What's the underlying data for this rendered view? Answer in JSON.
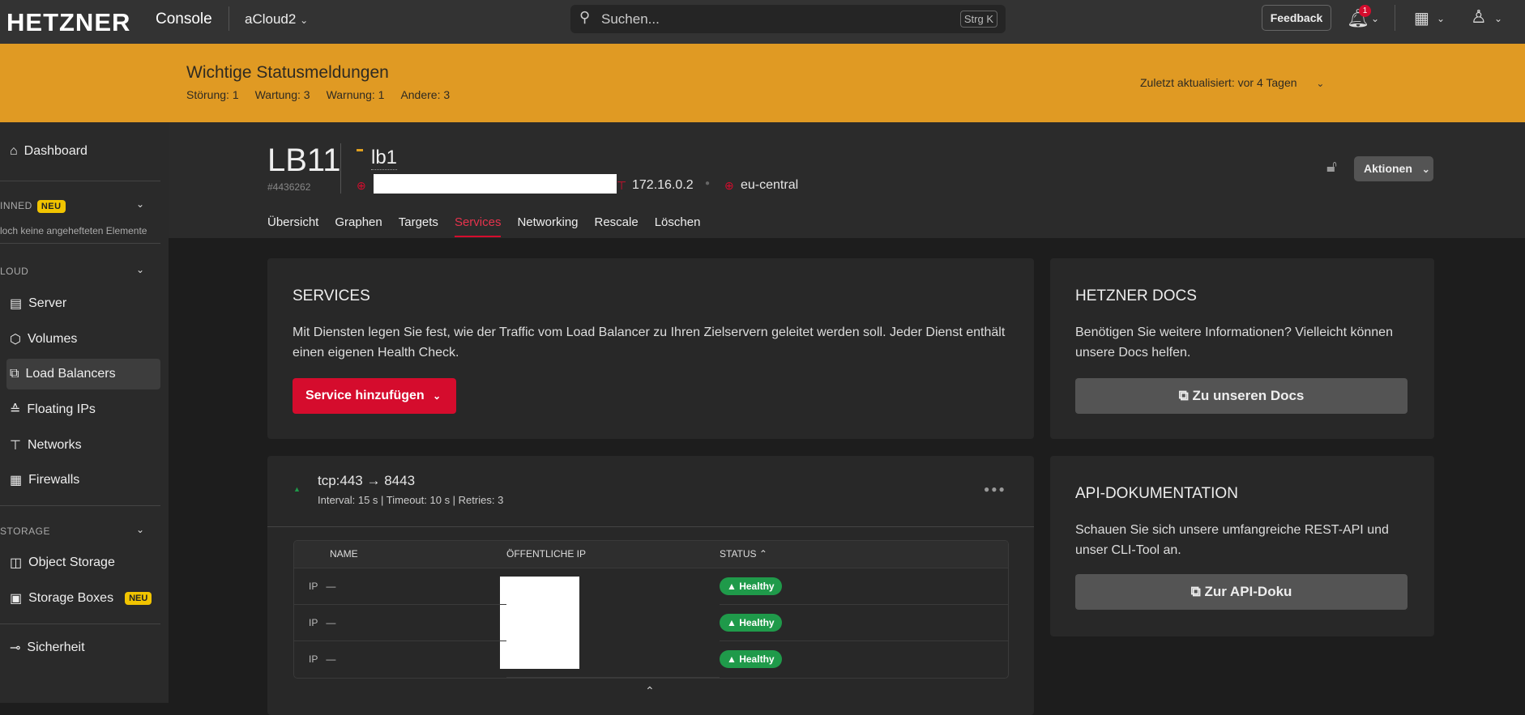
{
  "topbar": {
    "logo": "HETZNER",
    "console": "Console",
    "project": "aCloud2",
    "search_placeholder": "Suchen...",
    "shortcut": "Strg K",
    "feedback": "Feedback",
    "notif_count": "1"
  },
  "banner": {
    "title": "Wichtige Statusmeldungen",
    "stats": [
      "Störung: 1",
      "Wartung: 3",
      "Warnung: 1",
      "Andere: 3"
    ],
    "updated_label": "Zuletzt aktualisiert:",
    "updated_value": "vor 4 Tagen"
  },
  "sidebar": {
    "dashboard": "Dashboard",
    "pinned": "INNED",
    "neu": "NEU",
    "pinned_empty": "loch keine angehefteten Elemente",
    "cloud": "LOUD",
    "items": [
      "Server",
      "Volumes",
      "Load Balancers",
      "Floating IPs",
      "Networks",
      "Firewalls"
    ],
    "storage": "STORAGE",
    "storage_items": [
      "Object Storage",
      "Storage Boxes"
    ],
    "security": "Sicherheit"
  },
  "lb": {
    "type": "LB11",
    "id": "#4436262",
    "name": "lb1",
    "private_ip": "172.16.0.2",
    "location": "eu-central",
    "actions": "Aktionen",
    "tabs": [
      "Übersicht",
      "Graphen",
      "Targets",
      "Services",
      "Networking",
      "Rescale",
      "Löschen"
    ]
  },
  "services": {
    "title": "SERVICES",
    "text": "Mit Diensten legen Sie fest, wie der Traffic vom Load Balancer zu Ihren Zielservern geleitet werden soll. Jeder Dienst enthält einen eigenen Health Check.",
    "add": "Service hinzufügen"
  },
  "docs": {
    "title": "HETZNER DOCS",
    "text": "Benötigen Sie weitere Informationen? Vielleicht können unsere Docs helfen.",
    "button": "Zu unseren Docs"
  },
  "api": {
    "title": "API-DOKUMENTATION",
    "text": "Schauen Sie sich unsere umfangreiche REST-API und unser CLI-Tool an.",
    "button": "Zur API-Doku"
  },
  "service": {
    "name": "tcp:443 → 8443",
    "details": "Interval: 15 s | Timeout: 10 s | Retries: 3",
    "columns": [
      "NAME",
      "ÖFFENTLICHE IP",
      "STATUS"
    ],
    "rows": [
      {
        "type": "IP",
        "name": "—",
        "status": "Healthy"
      },
      {
        "type": "IP",
        "name": "—",
        "status": "Healthy"
      },
      {
        "type": "IP",
        "name": "—",
        "status": "Healthy"
      }
    ]
  }
}
